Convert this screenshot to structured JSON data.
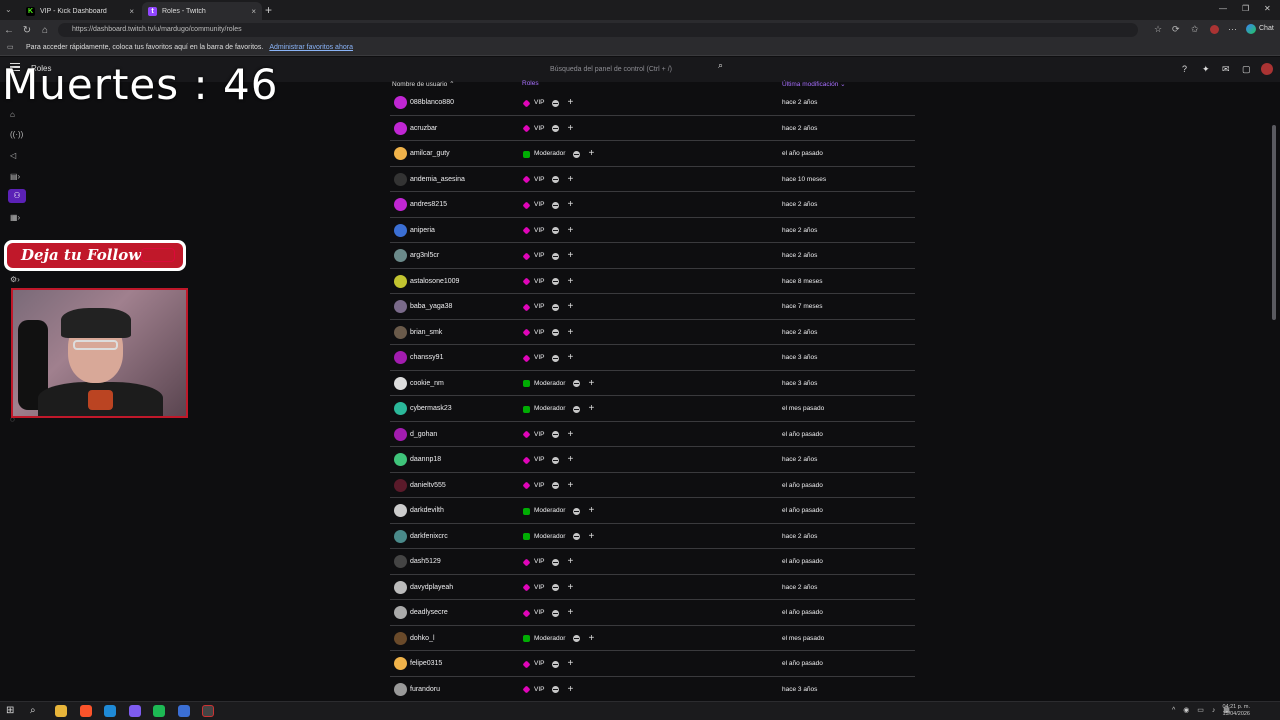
{
  "browser": {
    "tabs": [
      {
        "title": "VIP - Kick Dashboard",
        "icon": "kick-icon",
        "color": "#53fc18"
      },
      {
        "title": "Roles - Twitch",
        "icon": "twitch-icon",
        "color": "#9146ff"
      }
    ],
    "url": "https://dashboard.twitch.tv/u/mardugo/community/roles",
    "bookmarks_text": "Para acceder rápidamente, coloca tus favoritos aquí en la barra de favoritos.",
    "bookmarks_link": "Administrar favoritos ahora",
    "chat_label": "Chat"
  },
  "dashboard": {
    "page_title": "Roles",
    "search_placeholder": "Búsqueda del panel de control (Ctrl + /)"
  },
  "overlay": {
    "counter": "Muertes : 46",
    "follow": "Deja tu Follow"
  },
  "table": {
    "headers": {
      "user": "Nombre de usuario ⌃",
      "roles": "Roles",
      "modified": "Última modificación ⌄"
    },
    "rows": [
      {
        "name": "088blanco880",
        "role": "VIP",
        "date": "hace 2 años",
        "avatar": "#c026d3"
      },
      {
        "name": "acruzbar",
        "role": "VIP",
        "date": "hace 2 años",
        "avatar": "#c026d3"
      },
      {
        "name": "amilcar_guty",
        "role": "Moderador",
        "date": "el año pasado",
        "avatar": "#f0b34a"
      },
      {
        "name": "andemia_asesina",
        "role": "VIP",
        "date": "hace 10 meses",
        "avatar": "#333"
      },
      {
        "name": "andres8215",
        "role": "VIP",
        "date": "hace 2 años",
        "avatar": "#c026d3"
      },
      {
        "name": "aniperia",
        "role": "VIP",
        "date": "hace 2 años",
        "avatar": "#3b6fd4"
      },
      {
        "name": "arg3nl5cr",
        "role": "VIP",
        "date": "hace 2 años",
        "avatar": "#6b8a8a"
      },
      {
        "name": "astalosone1009",
        "role": "VIP",
        "date": "hace 8 meses",
        "avatar": "#c2c430"
      },
      {
        "name": "baba_yaga38",
        "role": "VIP",
        "date": "hace 7 meses",
        "avatar": "#7a6a8a"
      },
      {
        "name": "brian_smk",
        "role": "VIP",
        "date": "hace 2 años",
        "avatar": "#6a5a4a"
      },
      {
        "name": "chanssy91",
        "role": "VIP",
        "date": "hace 3 años",
        "avatar": "#a21caf"
      },
      {
        "name": "cookie_nm",
        "role": "Moderador",
        "date": "hace 3 años",
        "avatar": "#ddd"
      },
      {
        "name": "cybermask23",
        "role": "Moderador",
        "date": "el mes pasado",
        "avatar": "#2bb89a"
      },
      {
        "name": "d_gohan",
        "role": "VIP",
        "date": "el año pasado",
        "avatar": "#a21caf"
      },
      {
        "name": "daannp18",
        "role": "VIP",
        "date": "hace 2 años",
        "avatar": "#3fc47a"
      },
      {
        "name": "danieltv555",
        "role": "VIP",
        "date": "el año pasado",
        "avatar": "#5a1a2a"
      },
      {
        "name": "darkdevilth",
        "role": "Moderador",
        "date": "el año pasado",
        "avatar": "#ccc"
      },
      {
        "name": "darkfenixcrc",
        "role": "Moderador",
        "date": "hace 2 años",
        "avatar": "#4a8a8a"
      },
      {
        "name": "dash5129",
        "role": "VIP",
        "date": "el año pasado",
        "avatar": "#444"
      },
      {
        "name": "davydplayeah",
        "role": "VIP",
        "date": "hace 2 años",
        "avatar": "#bbb"
      },
      {
        "name": "deadlysecre",
        "role": "VIP",
        "date": "el año pasado",
        "avatar": "#aaa"
      },
      {
        "name": "dohko_l",
        "role": "Moderador",
        "date": "el mes pasado",
        "avatar": "#6a4a2a"
      },
      {
        "name": "felipe0315",
        "role": "VIP",
        "date": "el año pasado",
        "avatar": "#f0b34a"
      },
      {
        "name": "furandoru",
        "role": "VIP",
        "date": "hace 3 años",
        "avatar": "#999"
      }
    ]
  },
  "taskbar": {
    "time": "04:21 p. m.",
    "date": "15/04/2026"
  }
}
